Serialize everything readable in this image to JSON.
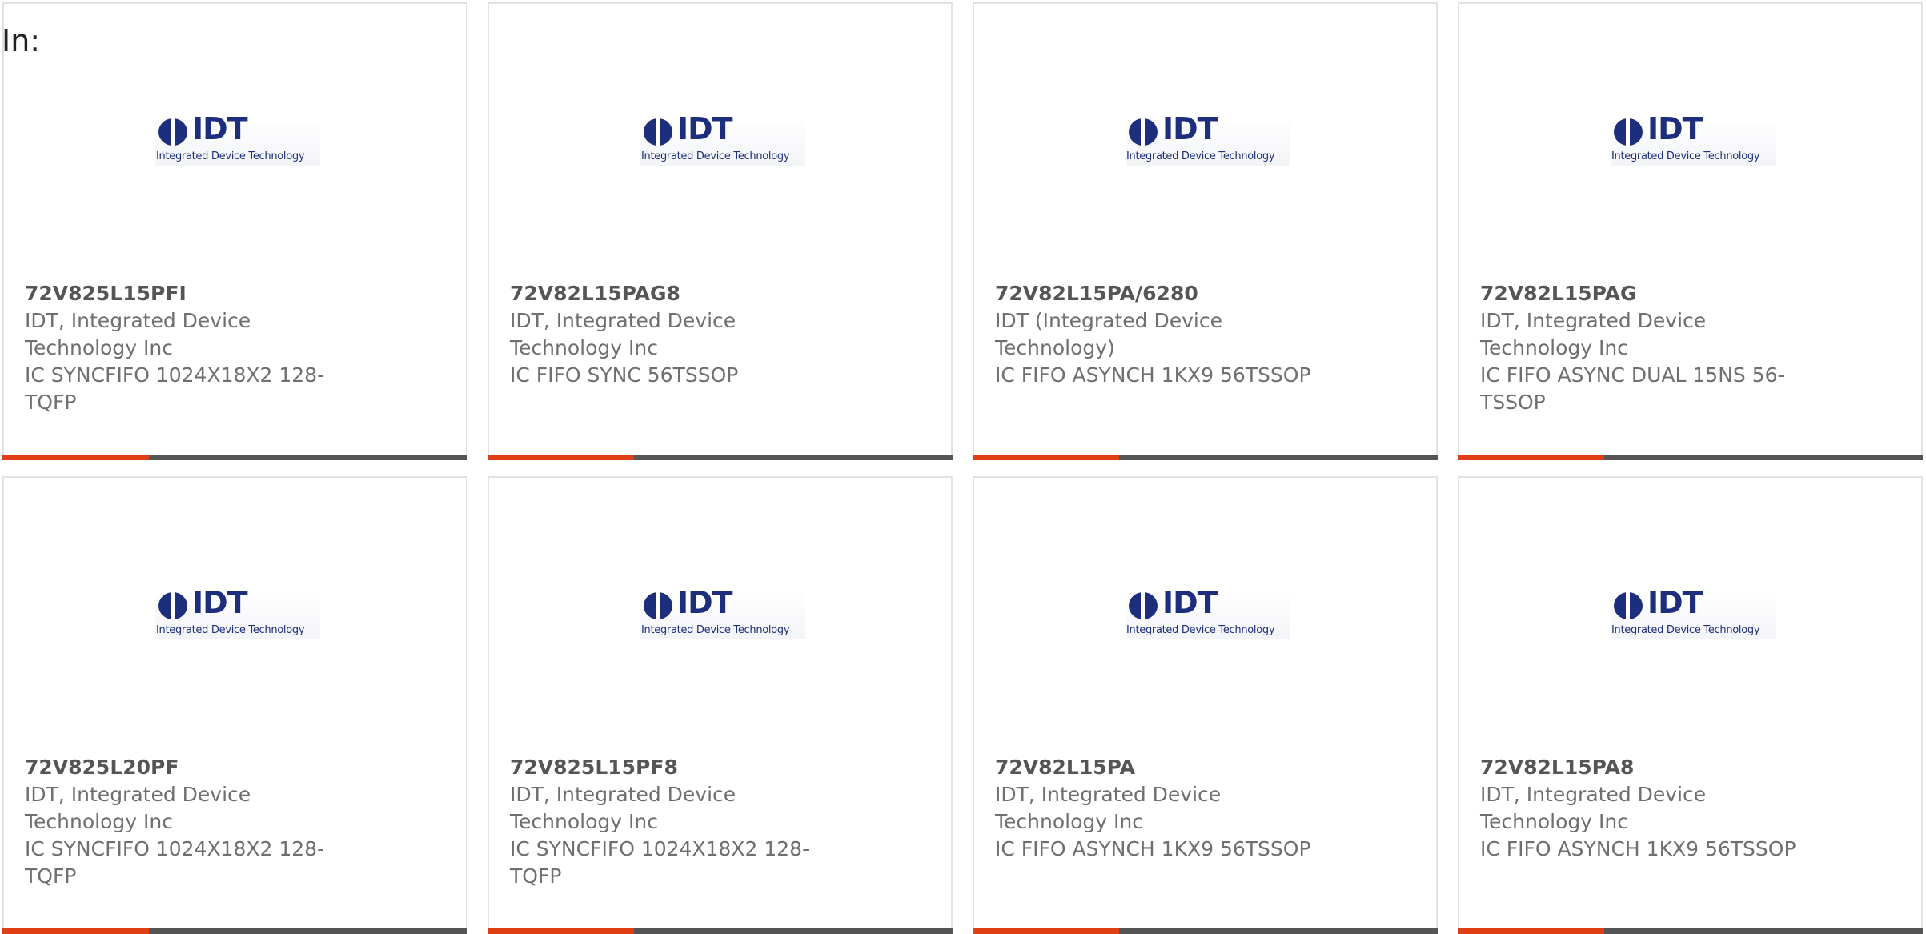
{
  "filter": {
    "label": "In:"
  },
  "logo": {
    "wordmark": "IDT",
    "tagline": "Integrated Device Technology"
  },
  "colors": {
    "brand_blue": "#1d2e7d",
    "accent_orange": "#e03e14",
    "bar_gray": "#555555",
    "text_gray": "#6f6f6f"
  },
  "products": [
    {
      "part_number": "72V825L15PFI",
      "manufacturer": "IDT, Integrated Device Technology Inc",
      "description": "IC SYNCFIFO 1024X18X2 128-TQFP"
    },
    {
      "part_number": "72V82L15PAG8",
      "manufacturer": "IDT, Integrated Device Technology Inc",
      "description": "IC FIFO SYNC 56TSSOP"
    },
    {
      "part_number": "72V82L15PA/6280",
      "manufacturer": "IDT (Integrated Device Technology)",
      "description": "IC FIFO ASYNCH 1KX9 56TSSOP"
    },
    {
      "part_number": "72V82L15PAG",
      "manufacturer": "IDT, Integrated Device Technology Inc",
      "description": "IC FIFO ASYNC DUAL 15NS 56-TSSOP"
    },
    {
      "part_number": "72V825L20PF",
      "manufacturer": "IDT, Integrated Device Technology Inc",
      "description": "IC SYNCFIFO 1024X18X2 128-TQFP"
    },
    {
      "part_number": "72V825L15PF8",
      "manufacturer": "IDT, Integrated Device Technology Inc",
      "description": "IC SYNCFIFO 1024X18X2 128-TQFP"
    },
    {
      "part_number": "72V82L15PA",
      "manufacturer": "IDT, Integrated Device Technology Inc",
      "description": "IC FIFO ASYNCH 1KX9 56TSSOP"
    },
    {
      "part_number": "72V82L15PA8",
      "manufacturer": "IDT, Integrated Device Technology Inc",
      "description": "IC FIFO ASYNCH 1KX9 56TSSOP"
    }
  ]
}
